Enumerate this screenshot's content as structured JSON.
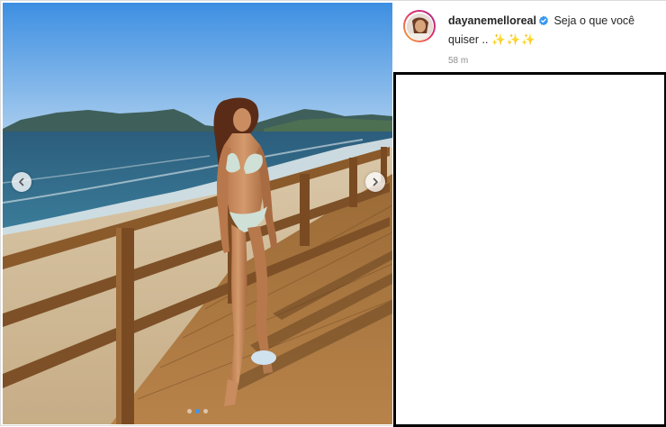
{
  "post": {
    "username": "dayanemelloreal",
    "verified": true,
    "caption_text": "Seja o que você quiser ..",
    "caption_emojis": "✨✨✨",
    "timestamp": "58 m"
  },
  "carousel": {
    "total_slides": 3,
    "active_slide": 2
  },
  "icons": {
    "verified": "verified-badge-icon",
    "prev": "chevron-left-icon",
    "next": "chevron-right-icon"
  },
  "colors": {
    "verified_blue": "#3897f0",
    "active_dot": "#3d97ee"
  }
}
